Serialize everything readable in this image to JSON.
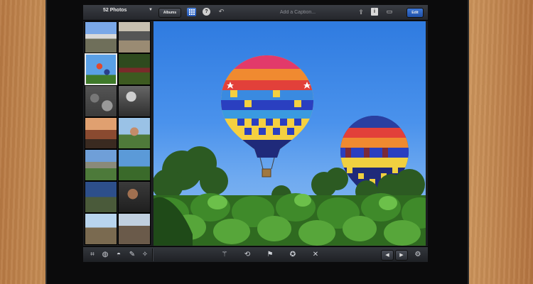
{
  "header": {
    "photo_count": "52 Photos",
    "albums_label": "Albums",
    "caption_placeholder": "Add a Caption...",
    "edit_label": "Edit"
  },
  "icons": {
    "dropdown": "chevron-down-icon",
    "grid": "grid-icon",
    "help": "help-icon",
    "undo": "undo-icon",
    "share": "share-icon",
    "info": "info-icon",
    "frame": "frame-icon",
    "crop": "crop-icon",
    "color": "color-wheel-icon",
    "palette": "palette-icon",
    "brushes": "brushes-icon",
    "effects": "effects-icon",
    "auto_enhance": "magic-wand-icon",
    "straighten": "rotate-icon",
    "flag": "flag-icon",
    "favorite": "award-icon",
    "hide": "close-icon",
    "previous": "arrow-left-icon",
    "next": "arrow-right-icon",
    "settings": "gear-icon"
  },
  "thumbnails": {
    "count_visible": 14,
    "selected_index": 2
  },
  "colors": {
    "accent": "#2f68cf",
    "toolbar": "#2a2c31",
    "sky": "#4a92ec"
  }
}
